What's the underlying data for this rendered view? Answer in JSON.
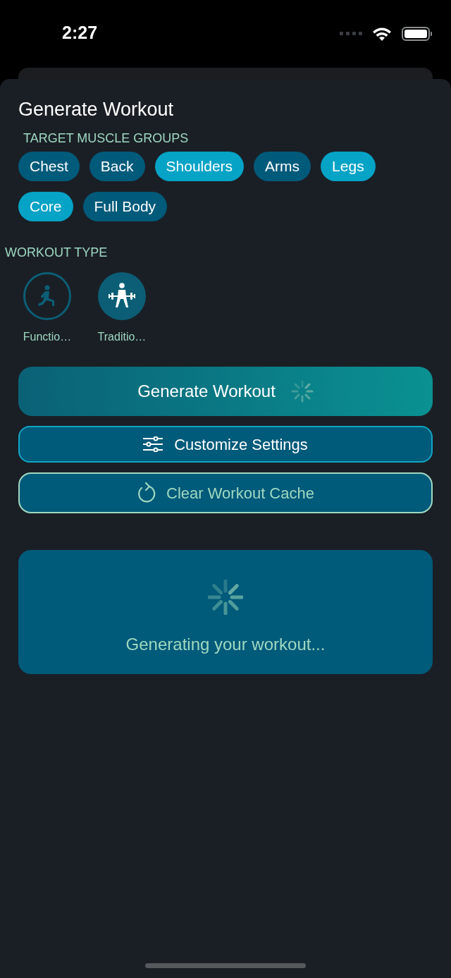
{
  "status_bar": {
    "time": "2:27"
  },
  "title": "Generate Workout",
  "muscle_groups": {
    "label": "TARGET MUSCLE GROUPS",
    "chips": [
      {
        "label": "Chest",
        "selected": false
      },
      {
        "label": "Back",
        "selected": false
      },
      {
        "label": "Shoulders",
        "selected": true
      },
      {
        "label": "Arms",
        "selected": false
      },
      {
        "label": "Legs",
        "selected": true
      },
      {
        "label": "Core",
        "selected": true
      },
      {
        "label": "Full Body",
        "selected": false
      }
    ]
  },
  "workout_type": {
    "label": "WORKOUT TYPE",
    "options": [
      {
        "kind": "functional",
        "label": "Functio…",
        "selected": false
      },
      {
        "kind": "traditional",
        "label": "Traditio…",
        "selected": true
      }
    ]
  },
  "buttons": [
    {
      "kind": "generate",
      "label": "Generate Workout",
      "loading": true
    },
    {
      "kind": "settings",
      "label": "Customize Settings"
    },
    {
      "kind": "clear",
      "label": "Clear Workout Cache"
    }
  ],
  "loading_card": {
    "message": "Generating your workout..."
  }
}
